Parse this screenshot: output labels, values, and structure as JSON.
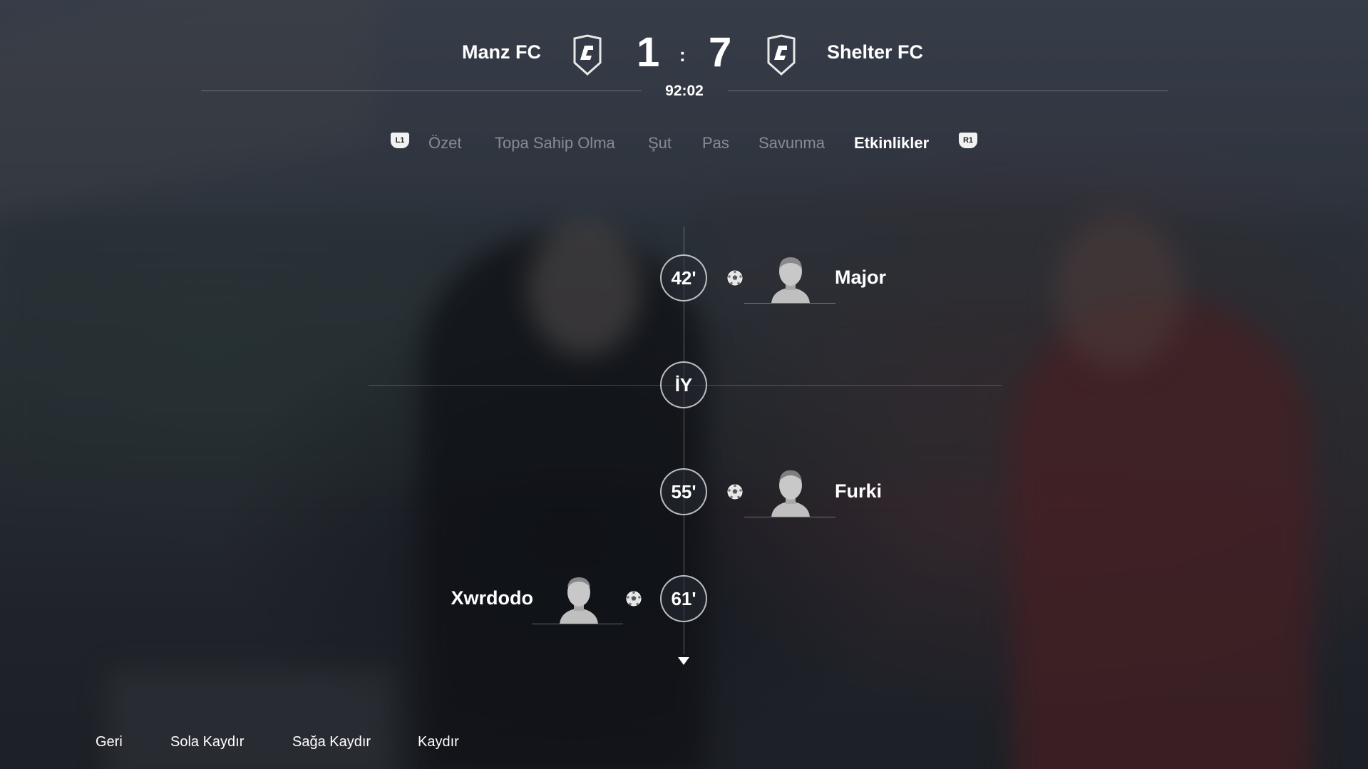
{
  "header": {
    "home_team": "Manz FC",
    "away_team": "Shelter FC",
    "home_score": "1",
    "away_score": "7",
    "separator": ":",
    "match_clock": "92:02",
    "crest_icon": "club-crest-icon"
  },
  "tabs": {
    "left_shoulder": "L1",
    "right_shoulder": "R1",
    "items": [
      {
        "label": "Özet"
      },
      {
        "label": "Topa Sahip Olma"
      },
      {
        "label": "Şut"
      },
      {
        "label": "Pas"
      },
      {
        "label": "Savunma"
      },
      {
        "label": "Etkinlikler",
        "active": true
      }
    ]
  },
  "events": [
    {
      "minute": "42'",
      "player": "Major",
      "side": "away",
      "type": "goal",
      "icon": "soccer-ball-icon"
    },
    {
      "minute": "İY",
      "type": "half-time"
    },
    {
      "minute": "55'",
      "player": "Furki",
      "side": "away",
      "type": "goal",
      "icon": "soccer-ball-icon"
    },
    {
      "minute": "61'",
      "player": "Xwrdodo",
      "side": "home",
      "type": "goal",
      "icon": "soccer-ball-icon"
    }
  ],
  "footer": {
    "back": "Geri",
    "scroll_left": "Sola Kaydır",
    "scroll_right": "Sağa Kaydır",
    "scroll": "Kaydır"
  },
  "colors": {
    "accent": "#ffffff",
    "inactive_tab": "#8c9098"
  }
}
